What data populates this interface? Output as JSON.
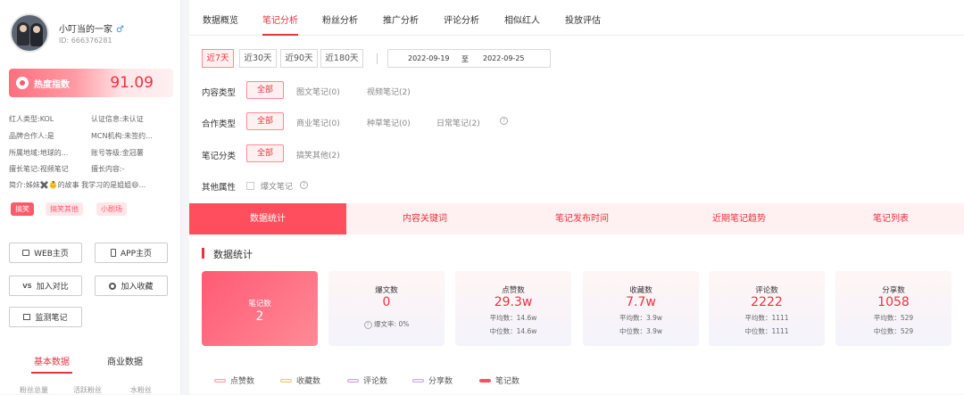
{
  "profile": {
    "name": "小叮当的一家",
    "gender_icon": "♂",
    "id": "ID: 666376281"
  },
  "hot_index": {
    "label": "热度指数",
    "value": "91.09"
  },
  "info": [
    {
      "k": "红人类型:",
      "v": "KOL"
    },
    {
      "k": "认证信息:",
      "v": "未认证"
    },
    {
      "k": "品牌合作人:",
      "v": "是"
    },
    {
      "k": "MCN机构:",
      "v": "未签约..."
    },
    {
      "k": "所属地域:",
      "v": "地球的..."
    },
    {
      "k": "账号等级:",
      "v": "金冠薯"
    },
    {
      "k": "擅长笔记:",
      "v": "视频笔记"
    },
    {
      "k": "擅长内容:",
      "v": "-"
    },
    {
      "k": "简介:",
      "v": "姊妹✖️👶的故事 我学习的是姐姐😄..."
    }
  ],
  "tags": [
    "搞笑",
    "搞笑其他",
    "小剧场"
  ],
  "side_buttons": {
    "web": "WEB主页",
    "app": "APP主页",
    "compare": "加入对比",
    "fav": "加入收藏",
    "monitor": "监测笔记"
  },
  "side_tabs": {
    "basic": "基本数据",
    "business": "商业数据"
  },
  "side_footer": [
    "粉丝总量",
    "活跃粉丝",
    "水粉丝"
  ],
  "nav": [
    "数据概览",
    "笔记分析",
    "粉丝分析",
    "推广分析",
    "评论分析",
    "相似红人",
    "投放评估"
  ],
  "ranges": [
    "近7天",
    "近30天",
    "近90天",
    "近180天"
  ],
  "date": {
    "start": "2022-09-19",
    "mid": "至",
    "end": "2022-09-25"
  },
  "filters": {
    "content": {
      "label": "内容类型",
      "opts": [
        "全部",
        "图文笔记(0)",
        "视频笔记(2)"
      ]
    },
    "coop": {
      "label": "合作类型",
      "opts": [
        "全部",
        "商业笔记(0)",
        "种草笔记(0)",
        "日常笔记(2)"
      ]
    },
    "cat": {
      "label": "笔记分类",
      "opts": [
        "全部",
        "搞笑其他(2)"
      ]
    },
    "other": {
      "label": "其他属性",
      "opt": "爆文笔记"
    }
  },
  "sub_tabs": [
    "数据统计",
    "内容关键词",
    "笔记发布时间",
    "近期笔记趋势",
    "笔记列表"
  ],
  "section_title": "数据统计",
  "cards": [
    {
      "label": "笔记数",
      "value": "2"
    },
    {
      "label": "爆文数",
      "value": "0",
      "s1": "爆文率:  0%"
    },
    {
      "label": "点赞数",
      "value": "29.3w",
      "s1": "平均数：14.6w",
      "s2": "中位数：14.6w"
    },
    {
      "label": "收藏数",
      "value": "7.7w",
      "s1": "平均数：3.9w",
      "s2": "中位数：3.9w"
    },
    {
      "label": "评论数",
      "value": "2222",
      "s1": "平均数：1111",
      "s2": "中位数：1111"
    },
    {
      "label": "分享数",
      "value": "1058",
      "s1": "平均数：529",
      "s2": "中位数：529"
    }
  ],
  "legend": [
    {
      "name": "点赞数",
      "color": "#f5a0a8"
    },
    {
      "name": "收藏数",
      "color": "#f2c27a"
    },
    {
      "name": "评论数",
      "color": "#d59be8"
    },
    {
      "name": "分享数",
      "color": "#c7a6f0"
    },
    {
      "name": "笔记数",
      "color": "#ff4f5e"
    }
  ]
}
